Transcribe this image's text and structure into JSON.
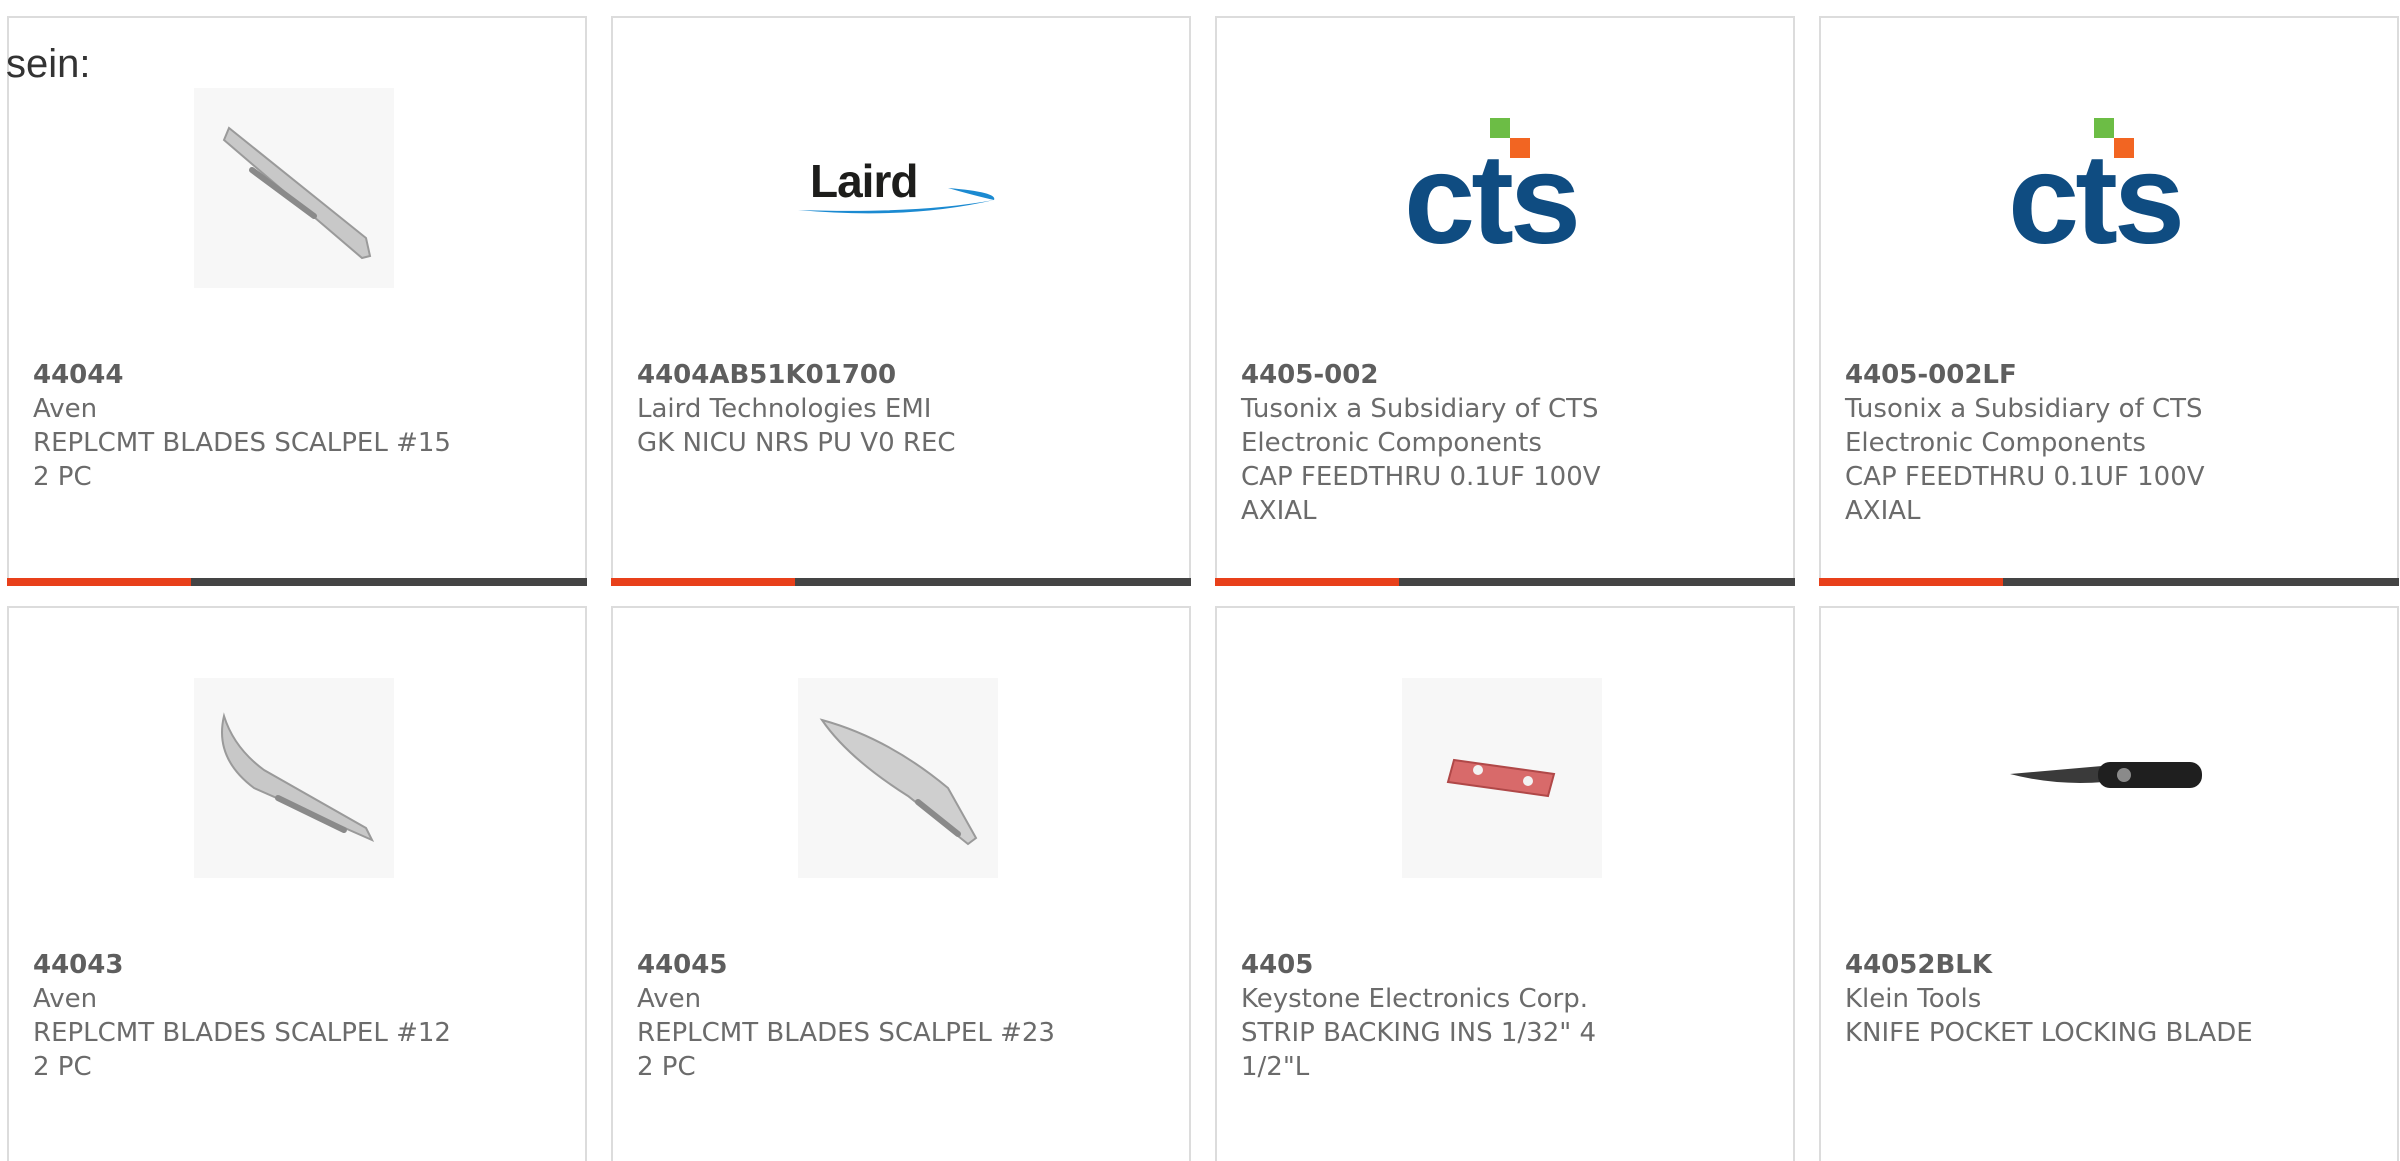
{
  "intro_text": "sein:",
  "products": [
    {
      "part_number": "44044",
      "manufacturer": "Aven",
      "description_lines": [
        "REPLCMT BLADES SCALPEL #15",
        "2 PC"
      ],
      "image": "scalpel-blade-15-image"
    },
    {
      "part_number": "4404AB51K01700",
      "manufacturer": "Laird Technologies EMI",
      "description_lines": [
        "GK NICU NRS PU V0 REC"
      ],
      "image": "laird-logo",
      "logo_text": "Laird"
    },
    {
      "part_number": "4405-002",
      "manufacturer": "Tusonix a Subsidiary of CTS",
      "description_lines": [
        "Electronic Components",
        "CAP FEEDTHRU 0.1UF 100V",
        "AXIAL"
      ],
      "image": "cts-logo",
      "logo_text": "cts"
    },
    {
      "part_number": "4405-002LF",
      "manufacturer": "Tusonix a Subsidiary of CTS",
      "description_lines": [
        "Electronic Components",
        "CAP FEEDTHRU 0.1UF 100V",
        "AXIAL"
      ],
      "image": "cts-logo",
      "logo_text": "cts"
    },
    {
      "part_number": "44043",
      "manufacturer": "Aven",
      "description_lines": [
        "REPLCMT BLADES SCALPEL #12",
        "2 PC"
      ],
      "image": "scalpel-blade-12-image"
    },
    {
      "part_number": "44045",
      "manufacturer": "Aven",
      "description_lines": [
        "REPLCMT BLADES SCALPEL #23",
        "2 PC"
      ],
      "image": "scalpel-blade-23-image"
    },
    {
      "part_number": "4405",
      "manufacturer": "Keystone Electronics Corp.",
      "description_lines": [
        "STRIP BACKING INS 1/32\" 4",
        "1/2\"L"
      ],
      "image": "insulator-strip-image"
    },
    {
      "part_number": "44052BLK",
      "manufacturer": "Klein Tools",
      "description_lines": [
        "KNIFE POCKET LOCKING BLADE"
      ],
      "image": "pocket-knife-image"
    }
  ],
  "colors": {
    "accent": "#e8401a",
    "bar": "#444444",
    "border": "#dcdcdc",
    "text": "#6b6b6b",
    "cts_blue": "#0f4c81",
    "cts_orange": "#f26522",
    "cts_green": "#6cbd45",
    "laird_blue": "#1b8ad1"
  }
}
